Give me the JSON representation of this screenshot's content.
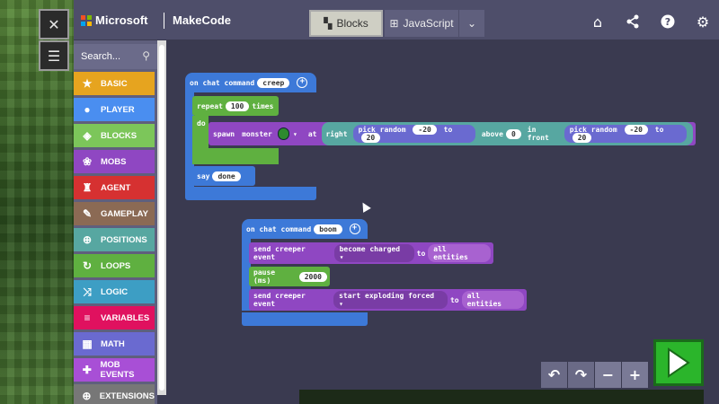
{
  "header": {
    "brand": "Microsoft",
    "product": "MakeCode",
    "tabs": [
      {
        "label": "Blocks",
        "active": true
      },
      {
        "label": "JavaScript",
        "active": false
      }
    ],
    "icons": [
      "home-icon",
      "share-icon",
      "help-icon",
      "settings-icon"
    ]
  },
  "toolbox": {
    "search_placeholder": "Search...",
    "categories": [
      {
        "label": "BASIC",
        "color": "#e6a41f",
        "icon": "star-icon"
      },
      {
        "label": "PLAYER",
        "color": "#4a8ef0",
        "icon": "person-icon"
      },
      {
        "label": "BLOCKS",
        "color": "#7cc65a",
        "icon": "cube-icon"
      },
      {
        "label": "MOBS",
        "color": "#8f47c2",
        "icon": "paw-icon"
      },
      {
        "label": "AGENT",
        "color": "#d63131",
        "icon": "agent-icon"
      },
      {
        "label": "GAMEPLAY",
        "color": "#8b6a54",
        "icon": "wrench-icon"
      },
      {
        "label": "POSITIONS",
        "color": "#57a7a1",
        "icon": "crosshair-icon"
      },
      {
        "label": "LOOPS",
        "color": "#5fb040",
        "icon": "loop-icon"
      },
      {
        "label": "LOGIC",
        "color": "#3d9ec4",
        "icon": "shuffle-icon"
      },
      {
        "label": "VARIABLES",
        "color": "#e0115f",
        "icon": "list-icon"
      },
      {
        "label": "MATH",
        "color": "#6a6ad0",
        "icon": "calculator-icon"
      },
      {
        "label": "MOB EVENTS",
        "color": "#a84fd6",
        "icon": "puzzle-icon"
      },
      {
        "label": "EXTENSIONS",
        "color": "#777777",
        "icon": "plus-icon"
      }
    ]
  },
  "program1": {
    "event_label": "on chat command",
    "command": "creep",
    "repeat_label": "repeat",
    "repeat_count": "100",
    "times_label": "times",
    "do_label": "do",
    "spawn_label": "spawn",
    "monster_label": "monster",
    "at_label": "at",
    "right_label": "right",
    "pick_random_label": "pick random",
    "rand1_min": "-20",
    "to_label": "to",
    "rand1_max": "20",
    "above_label": "above",
    "above_value": "0",
    "in_front_label": "in front",
    "rand2_min": "-20",
    "rand2_max": "20",
    "say_label": "say",
    "say_text": "done"
  },
  "program2": {
    "event_label": "on chat command",
    "command": "boom",
    "send1_label": "send creeper event",
    "send1_event": "become charged",
    "send1_to": "to",
    "send1_target": "all entities",
    "pause_label": "pause (ms)",
    "pause_value": "2000",
    "send2_label": "send creeper event",
    "send2_event": "start exploding forced",
    "send2_to": "to",
    "send2_target": "all entities"
  },
  "colors": {
    "event_blue": "#3d79d8",
    "loop_green": "#5fb040",
    "mob_purple": "#8f47c2",
    "run_green": "#2bb52b"
  }
}
